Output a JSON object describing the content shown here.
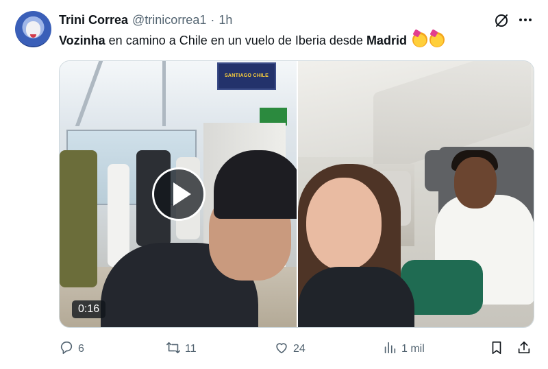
{
  "author": {
    "name": "Trini Correa",
    "handle": "@trinicorrea1",
    "separator": "·",
    "time": "1h"
  },
  "tweet": {
    "bold_start": "Vozinha",
    "middle": " en camino a Chile en un vuelo de Iberia desde ",
    "bold_end": "Madrid"
  },
  "media": {
    "video_duration": "0:16",
    "gate_sign_text": "SANTIAGO CHILE"
  },
  "actions": {
    "replies": "6",
    "reposts": "11",
    "likes": "24",
    "views": "1 mil"
  },
  "icons": [
    "grok-icon",
    "more-icon",
    "reply-icon",
    "repost-icon",
    "like-icon",
    "views-icon",
    "bookmark-icon",
    "share-icon",
    "play-icon",
    "party-emoji"
  ],
  "colors": {
    "text": "#0f1419",
    "secondary": "#536471",
    "border": "#cfd9de"
  }
}
